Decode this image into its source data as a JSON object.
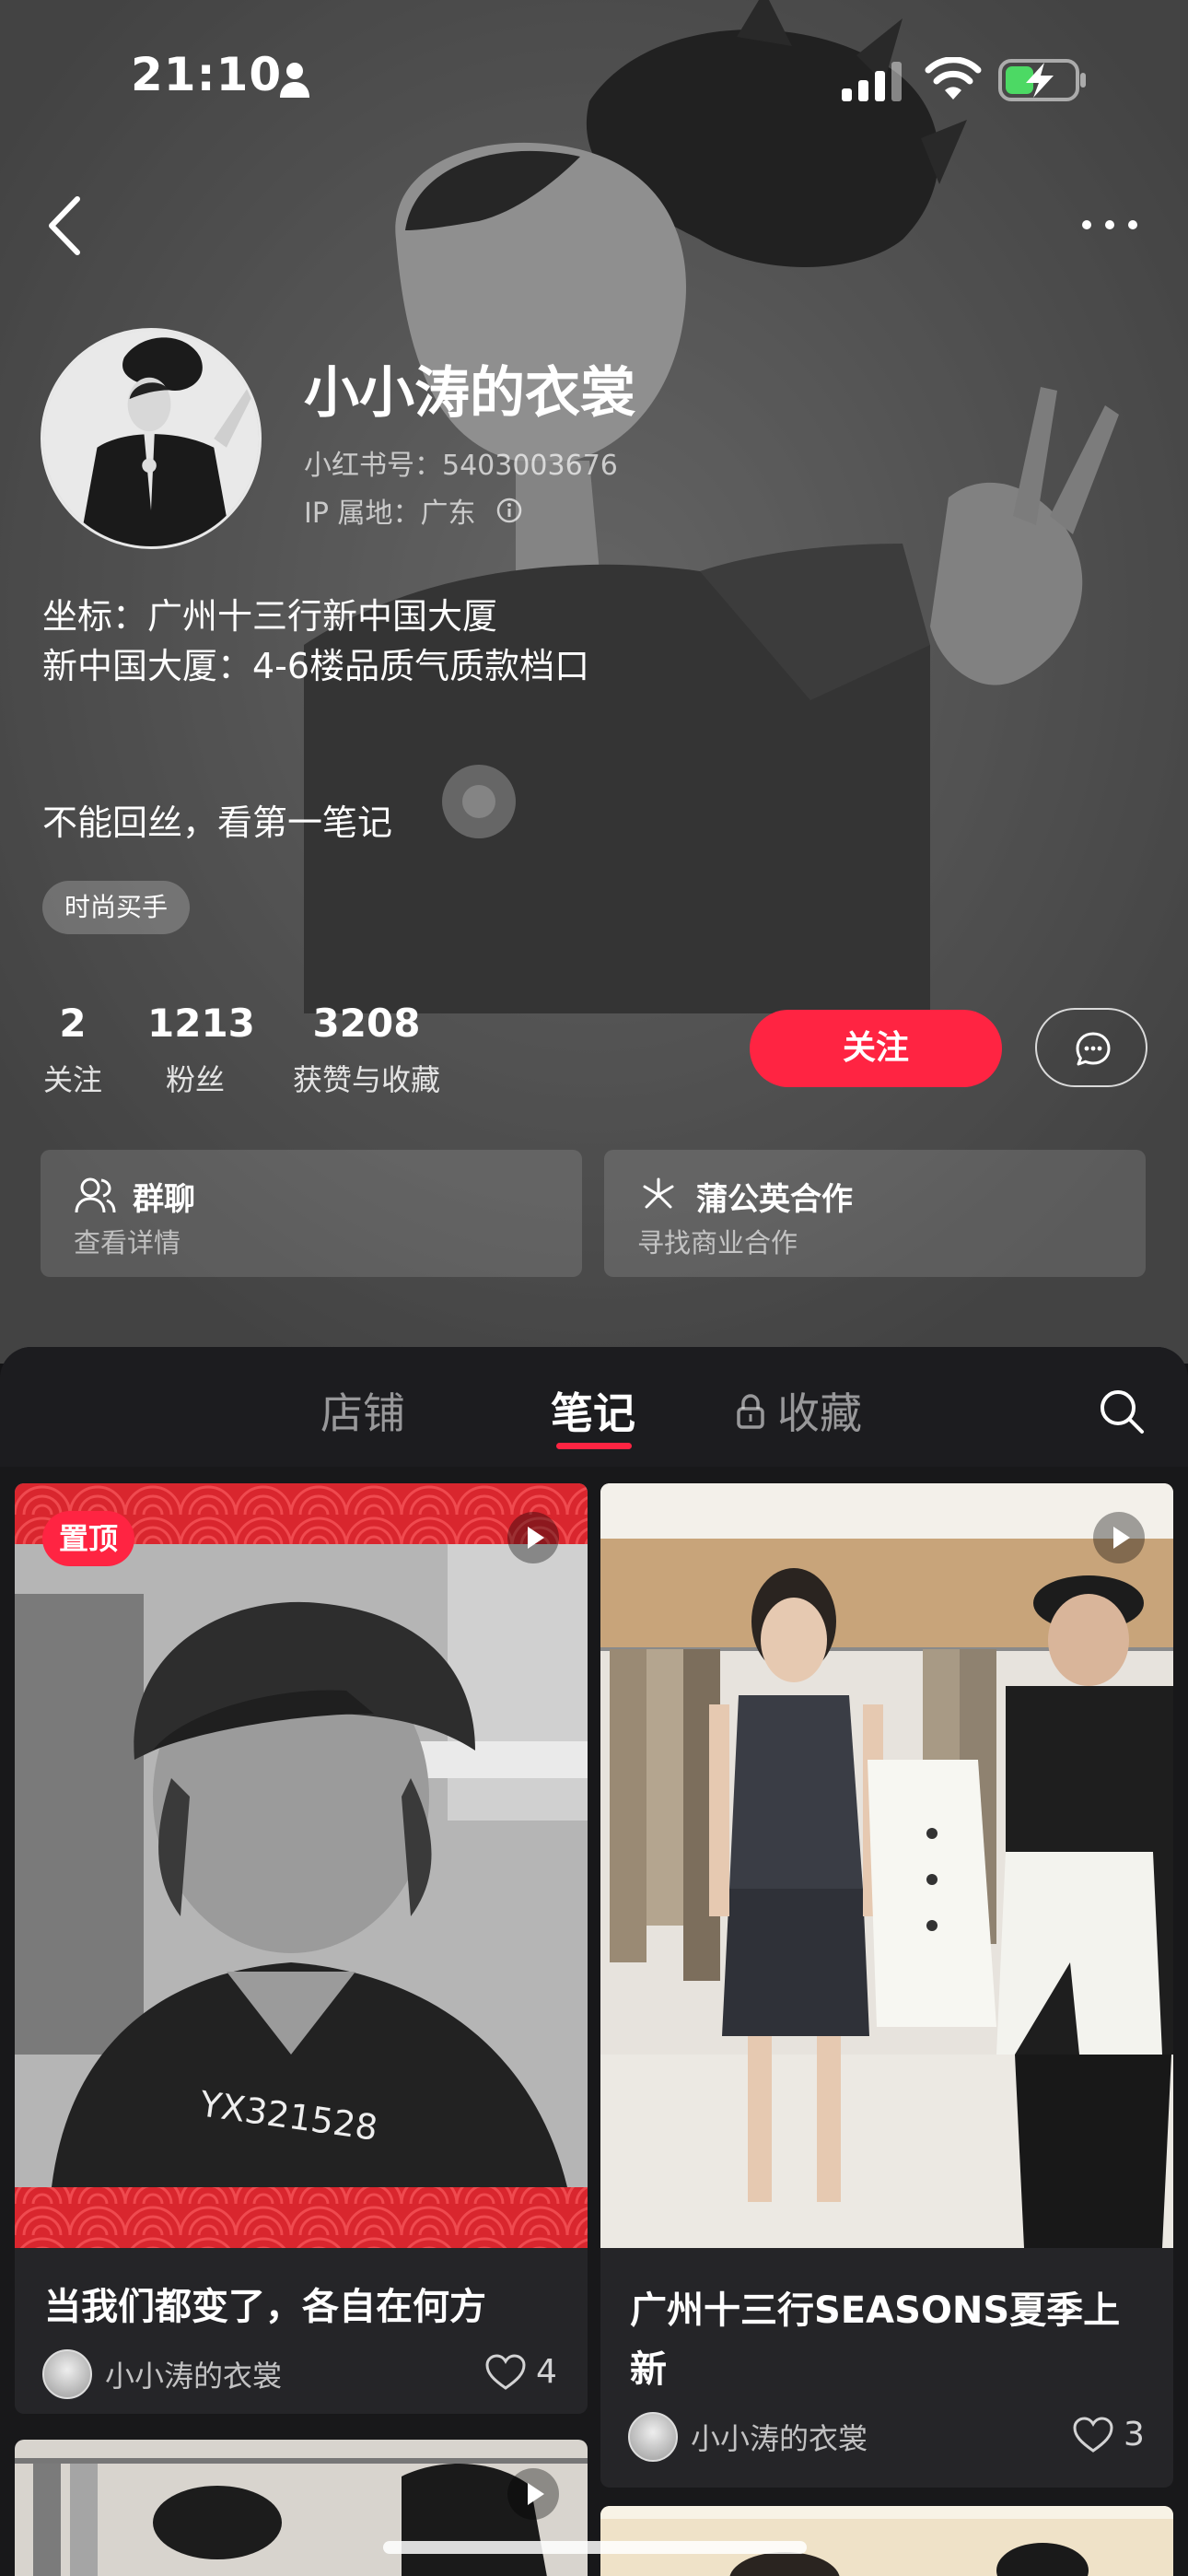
{
  "status_bar": {
    "time": "21:10"
  },
  "profile": {
    "nickname": "小小涛的衣裳",
    "red_id": "小红书号：5403003676",
    "ip_location": "IP 属地：广东",
    "bio_lines": [
      "坐标：广州十三行新中国大厦",
      "新中国大厦：4-6楼品质气质款档口"
    ],
    "bio_extra": "不能回丝，看第一笔记",
    "tag": "时尚买手"
  },
  "stats": [
    {
      "value": "2",
      "label": "关注"
    },
    {
      "value": "1213",
      "label": "粉丝"
    },
    {
      "value": "3208",
      "label": "获赞与收藏"
    }
  ],
  "actions": {
    "follow_label": "关注"
  },
  "quick_cards": [
    {
      "title": "群聊",
      "subtitle": "查看详情",
      "icon": "group-chat-icon"
    },
    {
      "title": "蒲公英合作",
      "subtitle": "寻找商业合作",
      "icon": "dandelion-icon"
    }
  ],
  "tabs": [
    {
      "label": "店铺",
      "active": false
    },
    {
      "label": "笔记",
      "active": true
    },
    {
      "label": "收藏",
      "active": false,
      "locked": true
    }
  ],
  "notes": [
    {
      "pinned_label": "置顶",
      "cover_text": "YX321528",
      "title": "当我们都变了，各自在何方",
      "author": "小小涛的衣裳",
      "likes": "4",
      "is_video": true
    },
    {
      "title_line1": "广州十三行SEASONS夏季上",
      "title_line2": "新",
      "author": "小小涛的衣裳",
      "likes": "3",
      "is_video": true
    }
  ],
  "colors": {
    "accent": "#ff2442",
    "sheet_bg": "#18181a",
    "hero_bg": "#5f5f5f"
  }
}
